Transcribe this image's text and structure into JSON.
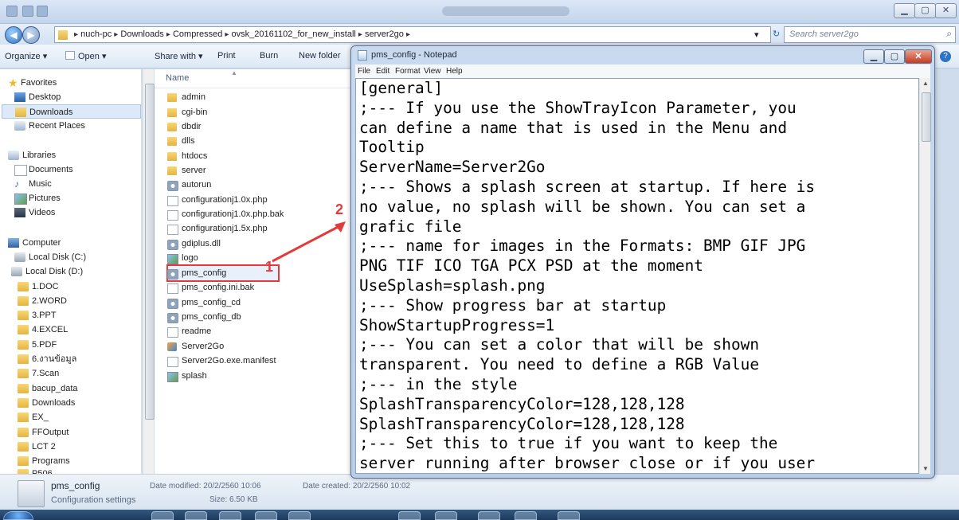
{
  "explorer": {
    "address": [
      "nuch-pc",
      "Downloads",
      "Compressed",
      "ovsk_20161102_for_new_install",
      "server2go"
    ],
    "search_placeholder": "Search server2go",
    "toolbar": {
      "organize": "Organize ▾",
      "open": "Open ▾",
      "share": "Share with ▾",
      "print": "Print",
      "burn": "Burn",
      "new_folder": "New folder"
    },
    "column_name": "Name",
    "nav": {
      "favorites": "Favorites",
      "fav_items": [
        "Desktop",
        "Downloads",
        "Recent Places"
      ],
      "libraries": "Libraries",
      "lib_items": [
        "Documents",
        "Music",
        "Pictures",
        "Videos"
      ],
      "computer": "Computer",
      "drives": [
        "Local Disk (C:)",
        "Local Disk (D:)"
      ],
      "d_folders": [
        "1.DOC",
        "2.WORD",
        "3.PPT",
        "4.EXCEL",
        "5.PDF",
        "6.งานข้อมูล",
        "7.Scan",
        "bacup_data",
        "Downloads",
        "EX_",
        "FFOutput",
        "LCT 2",
        "Programs",
        "P506"
      ]
    },
    "files": [
      {
        "name": "admin",
        "icon": "folder-icon"
      },
      {
        "name": "cgi-bin",
        "icon": "folder-icon"
      },
      {
        "name": "dbdir",
        "icon": "folder-icon"
      },
      {
        "name": "dlls",
        "icon": "folder-icon"
      },
      {
        "name": "htdocs",
        "icon": "folder-icon"
      },
      {
        "name": "server",
        "icon": "folder-icon"
      },
      {
        "name": "autorun",
        "icon": "settings-file-icon"
      },
      {
        "name": "configurationj1.0x.php",
        "icon": "file-icon"
      },
      {
        "name": "configurationj1.0x.php.bak",
        "icon": "file-icon"
      },
      {
        "name": "configurationj1.5x.php",
        "icon": "file-icon"
      },
      {
        "name": "gdiplus.dll",
        "icon": "dll-icon"
      },
      {
        "name": "logo",
        "icon": "image-icon"
      },
      {
        "name": "pms_config",
        "icon": "settings-file-icon"
      },
      {
        "name": "pms_config.ini.bak",
        "icon": "file-icon"
      },
      {
        "name": "pms_config_cd",
        "icon": "settings-file-icon"
      },
      {
        "name": "pms_config_db",
        "icon": "settings-file-icon"
      },
      {
        "name": "readme",
        "icon": "text-file-icon"
      },
      {
        "name": "Server2Go",
        "icon": "app-icon"
      },
      {
        "name": "Server2Go.exe.manifest",
        "icon": "file-icon"
      },
      {
        "name": "splash",
        "icon": "image-icon"
      }
    ],
    "status": {
      "name": "pms_config",
      "type": "Configuration settings",
      "modified_label": "Date modified: 20/2/2560 10:06",
      "created_label": "Date created: 20/2/2560 10:02",
      "size_label": "Size: 6.50 KB"
    }
  },
  "notepad": {
    "title": "pms_config - Notepad",
    "menu": [
      "File",
      "Edit",
      "Format",
      "View",
      "Help"
    ],
    "lines": [
      "[general]",
      ";--- If you use the ShowTrayIcon Parameter, you",
      "can define a name that is used in the Menu and",
      "Tooltip",
      "ServerName=Server2Go",
      ";--- Shows a splash screen at startup. If here is",
      "no value, no splash will be shown. You can set a",
      "grafic file",
      ";--- name for images in the Formats:  BMP GIF JPG",
      "PNG TIF ICO TGA PCX PSD at the moment",
      "UseSplash=splash.png",
      ";--- Show progress bar at startup",
      "ShowStartupProgress=1",
      ";--- You can set a color that will be shown",
      "transparent. You need to define a RGB Value",
      ";--- in the style",
      "SplashTransparencyColor=128,128,128",
      "SplashTransparencyColor=128,128,128",
      ";--- Set this to true if you want to keep the",
      "server running after browser close or if you user"
    ]
  },
  "annotations": {
    "step1": "1",
    "step2": "2"
  },
  "colors": {
    "annotation": "#e43a3a"
  }
}
